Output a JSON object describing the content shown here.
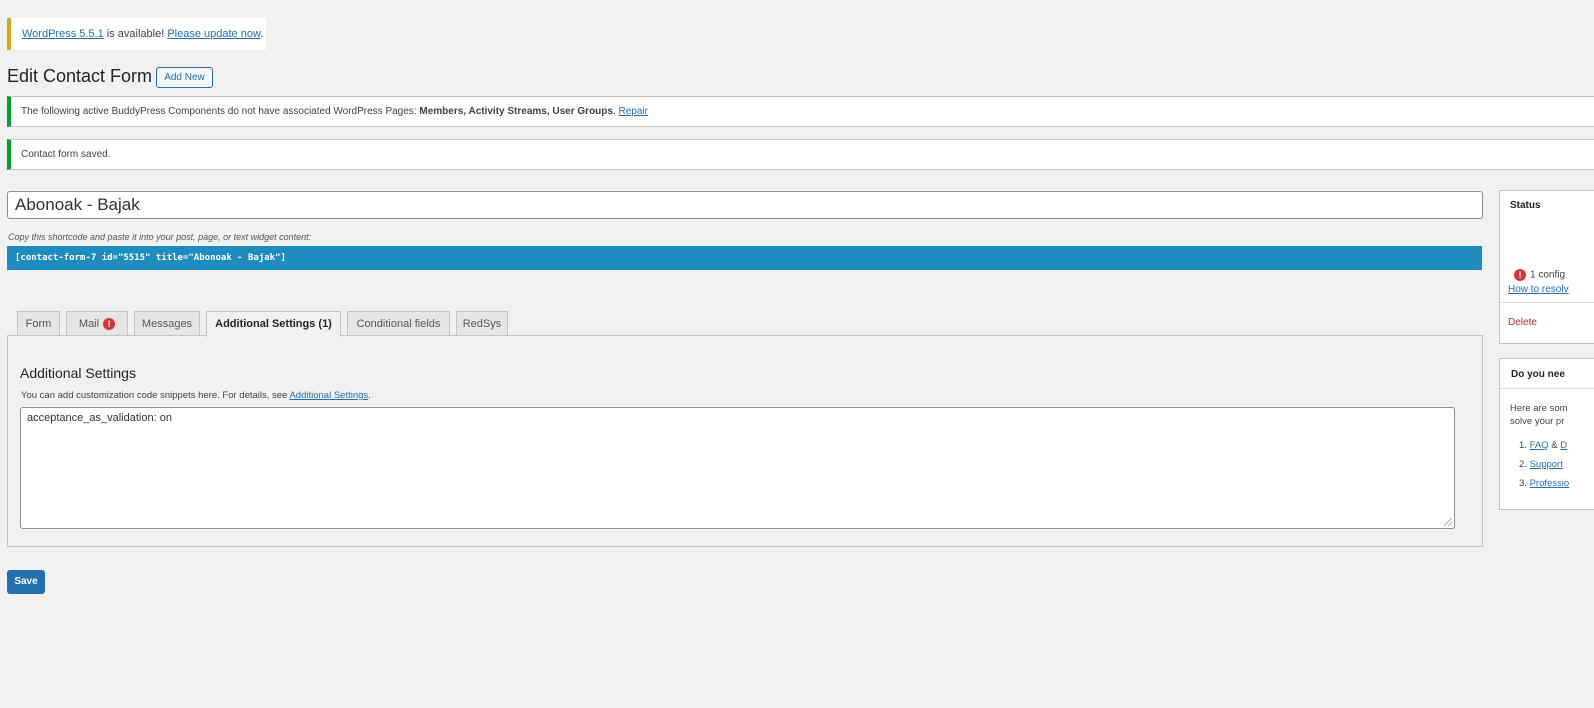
{
  "update_notice": {
    "version_link": "WordPress 5.5.1",
    "middle_text": " is available! ",
    "update_link": "Please update now",
    "end_text": "."
  },
  "header": {
    "title": "Edit Contact Form",
    "add_new_label": "Add New"
  },
  "notices": {
    "buddypress_prefix": "The following active BuddyPress Components do not have associated WordPress Pages: ",
    "buddypress_components": "Members, Activity Streams, User Groups",
    "buddypress_suffix": ". ",
    "repair_link": "Repair",
    "saved_message": "Contact form saved."
  },
  "form": {
    "title_value": "Abonoak - Bajak",
    "shortcode_hint": "Copy this shortcode and paste it into your post, page, or text widget content:",
    "shortcode": "[contact-form-7 id=\"5515\" title=\"Abonoak - Bajak\"]"
  },
  "tabs": [
    {
      "label": "Form"
    },
    {
      "label": "Mail",
      "badge": "!"
    },
    {
      "label": "Messages"
    },
    {
      "label": "Additional Settings (1)",
      "active": true
    },
    {
      "label": "Conditional fields"
    },
    {
      "label": "RedSys"
    }
  ],
  "panel": {
    "title": "Additional Settings",
    "desc_prefix": "You can add customization code snippets here. For details, see ",
    "desc_link": "Additional Settings",
    "desc_suffix": ".",
    "textarea_value": "acceptance_as_validation: on"
  },
  "save_label": "Save",
  "sidebar": {
    "status": {
      "title": "Status",
      "badge": "!",
      "config_text": "1 config",
      "howto_link": "How to resolv",
      "delete_label": "Delete"
    },
    "help": {
      "title": "Do you nee",
      "text_line1": "Here are som",
      "text_line2": "solve your pr",
      "items": [
        {
          "num": "1.",
          "link": "FAQ",
          "extra": " & ",
          "link2": "D"
        },
        {
          "num": "2.",
          "link": "Support"
        },
        {
          "num": "3.",
          "link": "Professio"
        }
      ]
    }
  }
}
